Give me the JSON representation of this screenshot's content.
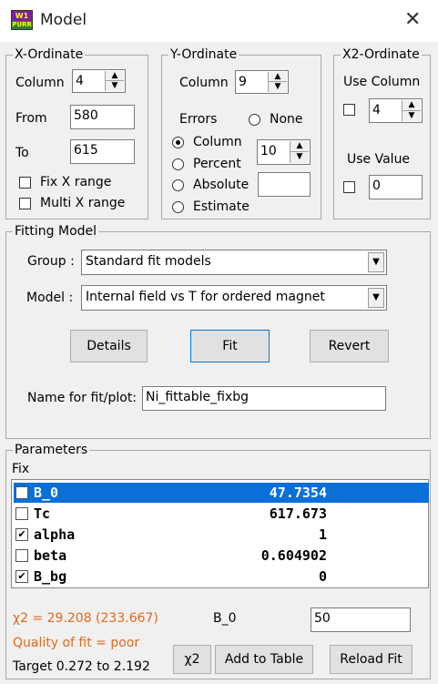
{
  "window": {
    "title": "Model",
    "close_glyph": "✕",
    "icon_top": "W1",
    "icon_bottom": "PURR"
  },
  "x_ordinate": {
    "label": "X-Ordinate",
    "column_label": "Column",
    "column_value": "4",
    "from_label": "From",
    "from_value": "580",
    "to_label": "To",
    "to_value": "615",
    "fix_label": "Fix X range",
    "multi_label": "Multi X range"
  },
  "y_ordinate": {
    "label": "Y-Ordinate",
    "column_label": "Column",
    "column_value": "9",
    "errors_label": "Errors",
    "none_label": "None",
    "column_opt": "Column",
    "percent_opt": "Percent",
    "absolute_opt": "Absolute",
    "estimate_opt": "Estimate",
    "err_column_value": "10",
    "absolute_value": ""
  },
  "x2_ordinate": {
    "label": "X2-Ordinate",
    "use_column_label": "Use Column",
    "use_column_value": "4",
    "use_value_label": "Use Value",
    "use_value_value": "0"
  },
  "fitting": {
    "label": "Fitting Model",
    "group_label": "Group :",
    "group_value": "Standard fit models",
    "model_label": "Model :",
    "model_value": "Internal field vs T for ordered magnet",
    "details_btn": "Details",
    "fit_btn": "Fit",
    "revert_btn": "Revert",
    "name_label": "Name for fit/plot:",
    "name_value": "Ni_fittable_fixbg"
  },
  "parameters": {
    "label": "Parameters",
    "fix_label": "Fix",
    "rows": [
      {
        "name": "B_0",
        "value": "47.7354",
        "fixed": false,
        "selected": true
      },
      {
        "name": "Tc",
        "value": "617.673",
        "fixed": false,
        "selected": false
      },
      {
        "name": "alpha",
        "value": "1",
        "fixed": true,
        "selected": false
      },
      {
        "name": "beta",
        "value": "0.604902",
        "fixed": false,
        "selected": false
      },
      {
        "name": "B_bg",
        "value": "0",
        "fixed": true,
        "selected": false
      }
    ],
    "chi2_text": "χ2 = 29.208 (233.667)",
    "quality_text": "Quality of fit = poor",
    "target_text": "Target 0.272 to 2.192",
    "edit_label": "B_0",
    "edit_value": "50",
    "chi2_btn": "χ2",
    "add_btn": "Add to Table",
    "reload_btn": "Reload Fit",
    "check_glyph": "✔"
  },
  "colors": {
    "selection": "#0a6fd8",
    "status": "#e06a1a",
    "focus": "#0078d7"
  }
}
